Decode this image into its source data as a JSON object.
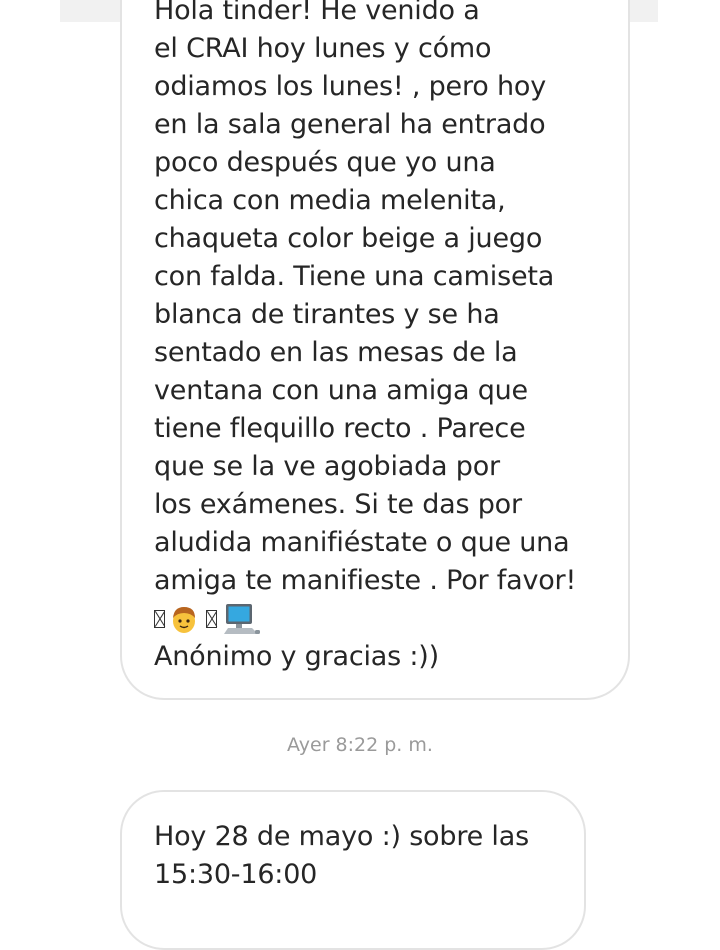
{
  "message_1": {
    "lines": [
      "Hola tinder! He venido a",
      "el CRAI hoy lunes y cómo",
      "odiamos los lunes! , pero hoy",
      "en la sala general ha entrado",
      "poco después que yo una",
      "chica con media melenita,",
      "chaqueta color beige a juego",
      "con falda. Tiene una camiseta",
      "blanca de tirantes y se ha",
      "sentado en las mesas de la",
      "ventana con una amiga que",
      "tiene flequillo recto . Parece",
      "que se la ve agobiada por",
      "los exámenes. Si te das por",
      "aludida manifiéstate o que una",
      "amiga te manifieste . Por favor!"
    ],
    "emoji_row": [
      "missing-glyph",
      "boy-emoji",
      "missing-glyph",
      "computer-emoji"
    ],
    "signoff": "Anónimo y gracias :))"
  },
  "timestamp": "Ayer 8:22 p. m.",
  "message_2": {
    "lines": [
      "Hoy 28 de mayo :) sobre las",
      "15:30-16:00"
    ]
  }
}
